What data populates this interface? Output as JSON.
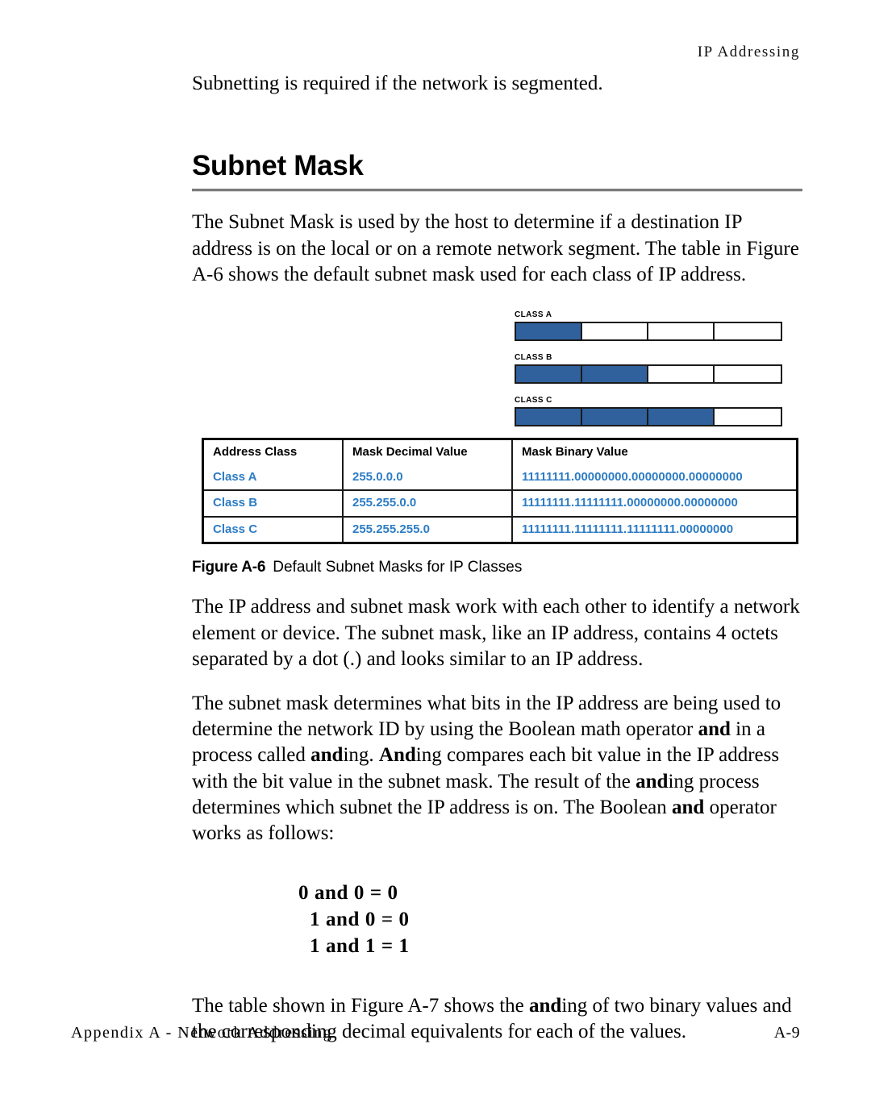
{
  "running_head": "IP Addressing",
  "lead_paragraph": "Subnetting is required if the network is segmented.",
  "section": {
    "heading": "Subnet Mask",
    "intro_paragraph": "The Subnet Mask is used by the host to determine if a destination IP address is on the local or on a remote network segment. The table in Figure A-6 shows the default subnet mask used for each class of IP address."
  },
  "figure": {
    "caption_label": "Figure A-6",
    "caption_text": "Default Subnet Masks for IP Classes",
    "bar_fill_color": "#30619c",
    "classes": [
      {
        "label": "CLASS A",
        "filled_octets": 1,
        "total_octets": 4
      },
      {
        "label": "CLASS B",
        "filled_octets": 2,
        "total_octets": 4
      },
      {
        "label": "CLASS C",
        "filled_octets": 3,
        "total_octets": 4
      }
    ],
    "table": {
      "text_color": "#2d7cc4",
      "headers": [
        "Address Class",
        "Mask Decimal Value",
        "Mask Binary Value"
      ],
      "rows": [
        [
          "Class A",
          "255.0.0.0",
          "11111111.00000000.00000000.00000000"
        ],
        [
          "Class B",
          "255.255.0.0",
          "11111111.11111111.00000000.00000000"
        ],
        [
          "Class C",
          "255.255.255.0",
          "11111111.11111111.11111111.00000000"
        ]
      ]
    }
  },
  "paragraphs": {
    "octets": "The IP address and subnet mask work with each other to identify a network element or device. The subnet mask, like an IP address, contains 4 octets separated by a dot (.) and looks similar to an IP address.",
    "anding_part1": "The subnet mask determines what bits in the IP address are being used to determine the network ID by using the Boolean math operator ",
    "anding_bold1": "and",
    "anding_part2": " in a process called ",
    "anding_bold2": "and",
    "anding_part3": "ing. ",
    "anding_bold3": "And",
    "anding_part4": "ing compares each bit value in the IP address with the bit value in the subnet mask. The result of the ",
    "anding_bold4": "and",
    "anding_part5": "ing process determines which subnet the IP address is on. The Boolean ",
    "anding_bold5": "and",
    "anding_part6": " operator works as follows:",
    "final_part1": "The table shown in Figure A-7 shows the ",
    "final_bold1": "and",
    "final_part2": "ing of two binary values and the corresponding decimal equivalents for each of the values."
  },
  "boolean_rules": [
    "0 and 0 = 0",
    "1 and 0 = 0",
    "1 and 1 = 1"
  ],
  "footer": {
    "left": "Appendix A - Network Addressing",
    "right": "A-9"
  }
}
